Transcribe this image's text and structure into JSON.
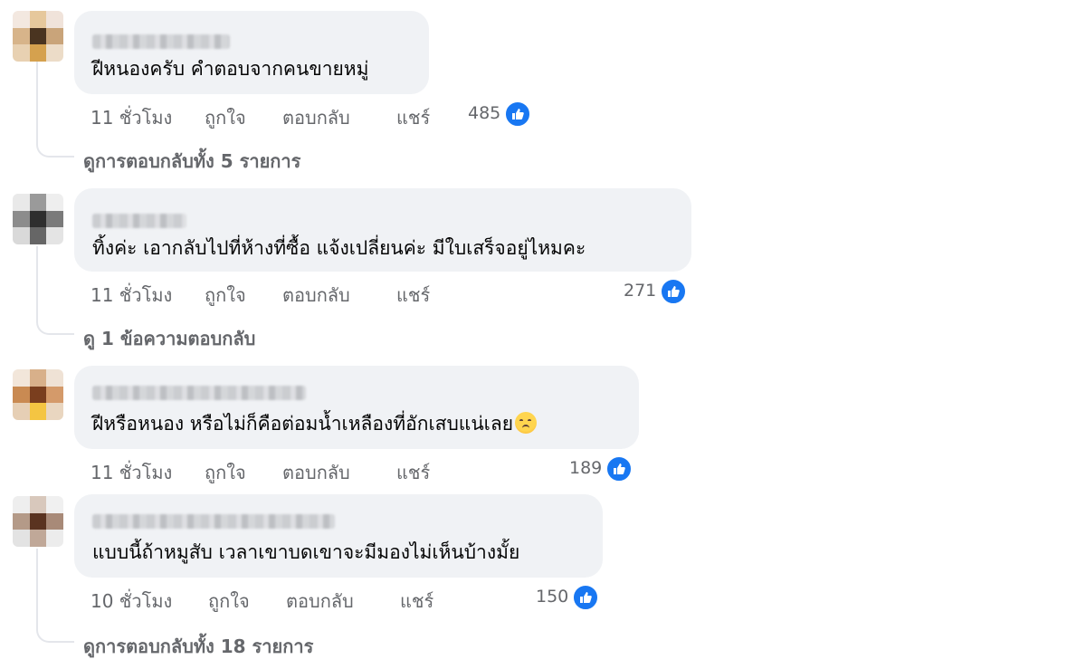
{
  "comments": [
    {
      "text": "ฝีหนองครับ คำตอบจากคนขายหมู่",
      "time": "11 ชั่วโมง",
      "like": "ถูกใจ",
      "reply": "ตอบกลับ",
      "share": "แชร์",
      "reactions": "485",
      "view_replies": "ดูการตอบกลับทั้ง 5 รายการ"
    },
    {
      "text": "ทิ้งค่ะ เอากลับไปที่ห้างที่ซื้อ แจ้งเปลี่ยนค่ะ มีใบเสร็จอยู่ไหมคะ",
      "time": "11 ชั่วโมง",
      "like": "ถูกใจ",
      "reply": "ตอบกลับ",
      "share": "แชร์",
      "reactions": "271",
      "view_replies": "ดู 1 ข้อความตอบกลับ"
    },
    {
      "text": "ฝีหรือหนอง หรือไม่ก็คือต่อมน้ำเหลืองที่อักเสบแน่เลย",
      "emoji": "sick-face-emoji",
      "time": "11 ชั่วโมง",
      "like": "ถูกใจ",
      "reply": "ตอบกลับ",
      "share": "แชร์",
      "reactions": "189"
    },
    {
      "text": "แบบนี้ถ้าหมูสับ เวลาเขาบดเขาจะมีมองไม่เห็นบ้างมั้ย",
      "time": "10 ชั่วโมง",
      "like": "ถูกใจ",
      "reply": "ตอบกลับ",
      "share": "แชร์",
      "reactions": "150",
      "view_replies": "ดูการตอบกลับทั้ง 18 รายการ"
    }
  ],
  "colors": {
    "bubble": "#f0f2f5",
    "meta_text": "#65676b",
    "like_blue": "#1877f2"
  },
  "icons": {
    "reaction": "like-thumb-icon",
    "avatar": "blurred-avatar"
  }
}
